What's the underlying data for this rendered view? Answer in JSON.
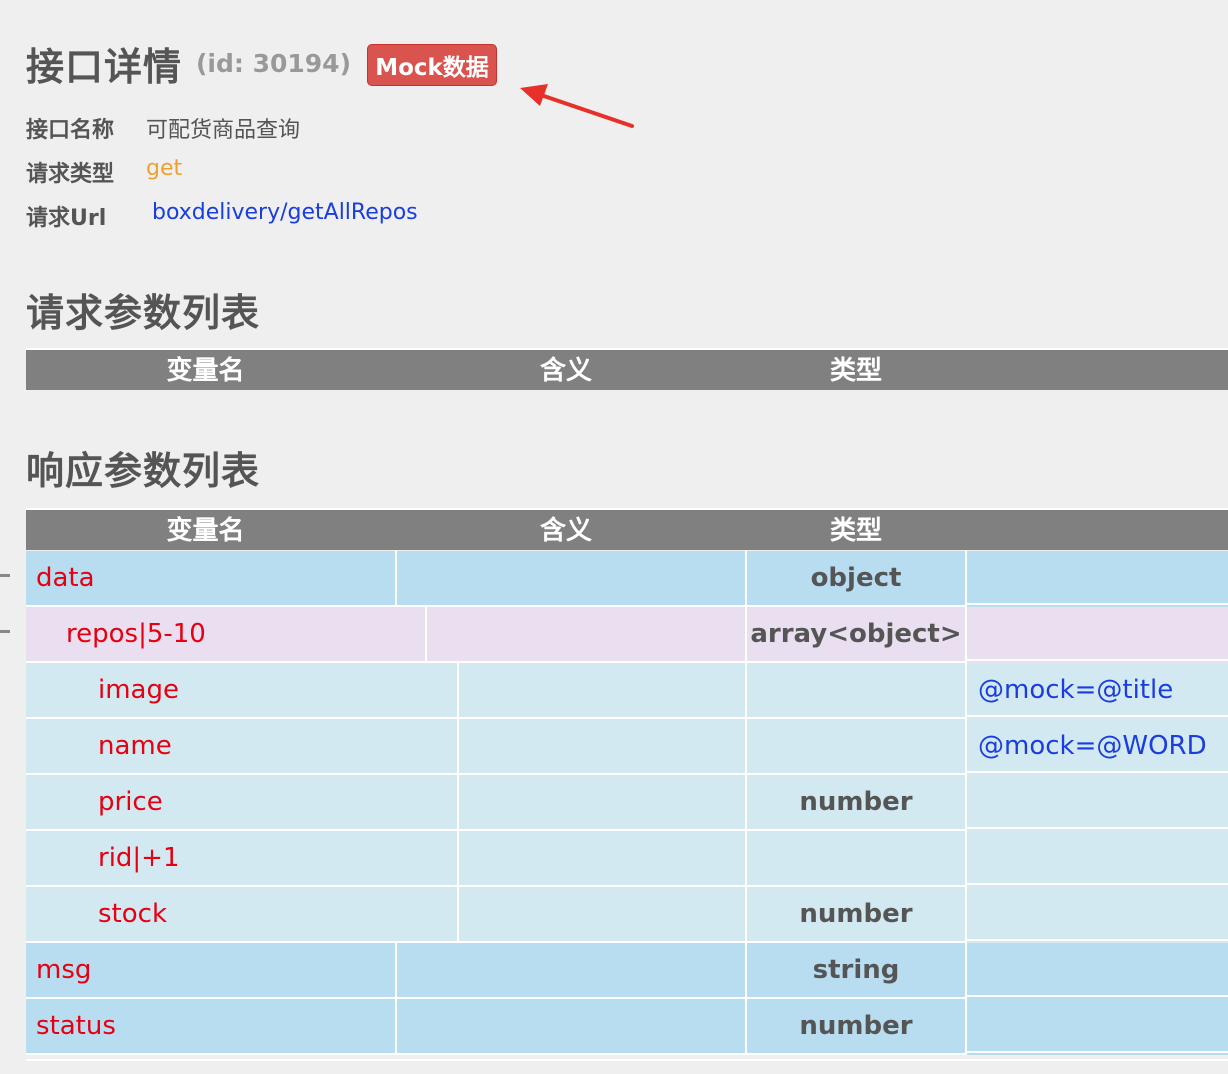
{
  "header": {
    "title": "接口详情",
    "id_text": "(id: 30194)",
    "mock_button": "Mock数据"
  },
  "info": {
    "name_label": "接口名称",
    "name_value": "可配货商品查询",
    "method_label": "请求类型",
    "method_value": "get",
    "url_label": "请求Url",
    "url_value": "boxdelivery/getAllRepos"
  },
  "request_section": {
    "title": "请求参数列表",
    "columns": [
      "变量名",
      "含义",
      "类型"
    ]
  },
  "response_section": {
    "title": "响应参数列表",
    "columns": [
      "变量名",
      "含义",
      "类型"
    ],
    "rows": [
      {
        "name": "data",
        "meaning": "",
        "type": "object",
        "remark": ""
      },
      {
        "name": "repos|5-10",
        "meaning": "",
        "type": "array<object>",
        "remark": ""
      },
      {
        "name": "image",
        "meaning": "",
        "type": "",
        "remark": "@mock=@title"
      },
      {
        "name": "name",
        "meaning": "",
        "type": "",
        "remark": "@mock=@WORD"
      },
      {
        "name": "price",
        "meaning": "",
        "type": "number",
        "remark": ""
      },
      {
        "name": "rid|+1",
        "meaning": "",
        "type": "",
        "remark": ""
      },
      {
        "name": "stock",
        "meaning": "",
        "type": "number",
        "remark": ""
      },
      {
        "name": "msg",
        "meaning": "",
        "type": "string",
        "remark": ""
      },
      {
        "name": "status",
        "meaning": "",
        "type": "number",
        "remark": ""
      }
    ]
  },
  "colors": {
    "mock_button": "#d9534f",
    "table_header": "#808080",
    "row_level0": "#b8ddf1",
    "row_level1": "#eadff0",
    "row_level2": "#d3e9f1",
    "param_name": "#e60012",
    "link": "#1a3de0",
    "method": "#f0a030",
    "arrow": "#e8302a"
  }
}
